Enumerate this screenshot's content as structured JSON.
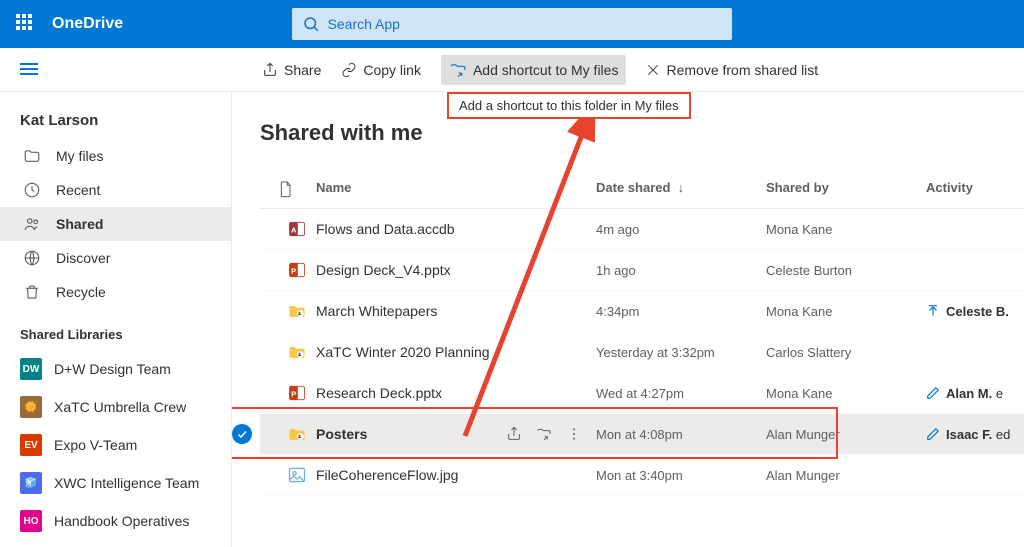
{
  "app": {
    "name": "OneDrive"
  },
  "search": {
    "placeholder": "Search App"
  },
  "commands": {
    "share": "Share",
    "copy_link": "Copy link",
    "add_shortcut": "Add shortcut to My files",
    "remove_shared": "Remove from shared list"
  },
  "tooltip": "Add a shortcut to this folder in My files",
  "user": {
    "name": "Kat Larson"
  },
  "nav": {
    "my_files": "My files",
    "recent": "Recent",
    "shared": "Shared",
    "discover": "Discover",
    "recycle": "Recycle"
  },
  "libraries": {
    "title": "Shared Libraries",
    "items": [
      {
        "badge": "DW",
        "color": "#038387",
        "label": "D+W Design Team"
      },
      {
        "badge": "🌼",
        "color": "#9b6a3a",
        "label": "XaTC Umbrella Crew",
        "emoji": true
      },
      {
        "badge": "EV",
        "color": "#d83b01",
        "label": "Expo V-Team"
      },
      {
        "badge": "🧊",
        "color": "#4f6bed",
        "label": "XWC Intelligence Team",
        "emoji": true
      },
      {
        "badge": "HO",
        "color": "#e3008c",
        "label": "Handbook Operatives"
      }
    ]
  },
  "page": {
    "title": "Shared with me",
    "columns": {
      "name": "Name",
      "date": "Date shared",
      "shared_by": "Shared by",
      "activity": "Activity"
    },
    "rows": [
      {
        "icon": "access",
        "name": "Flows and Data.accdb",
        "date": "4m ago",
        "shared_by": "Mona Kane"
      },
      {
        "icon": "ppt",
        "name": "Design Deck_V4.pptx",
        "date": "1h ago",
        "shared_by": "Celeste Burton"
      },
      {
        "icon": "folder-s",
        "name": "March Whitepapers",
        "date": "4:34pm",
        "shared_by": "Mona Kane",
        "activity": {
          "icon": "upload",
          "who": "Celeste B.",
          "rest": ""
        }
      },
      {
        "icon": "folder-s",
        "name": "XaTC Winter 2020 Planning",
        "date": "Yesterday at 3:32pm",
        "shared_by": "Carlos Slattery"
      },
      {
        "icon": "ppt",
        "name": "Research Deck.pptx",
        "date": "Wed at 4:27pm",
        "shared_by": "Mona Kane",
        "activity": {
          "icon": "edit",
          "who": "Alan M.",
          "rest": " e"
        }
      },
      {
        "icon": "folder-s",
        "name": "Posters",
        "date": "Mon at 4:08pm",
        "shared_by": "Alan Munger",
        "selected": true,
        "activity": {
          "icon": "edit",
          "who": "Isaac F.",
          "rest": " ed"
        }
      },
      {
        "icon": "image",
        "name": "FileCoherenceFlow.jpg",
        "date": "Mon at 3:40pm",
        "shared_by": "Alan Munger"
      }
    ]
  }
}
